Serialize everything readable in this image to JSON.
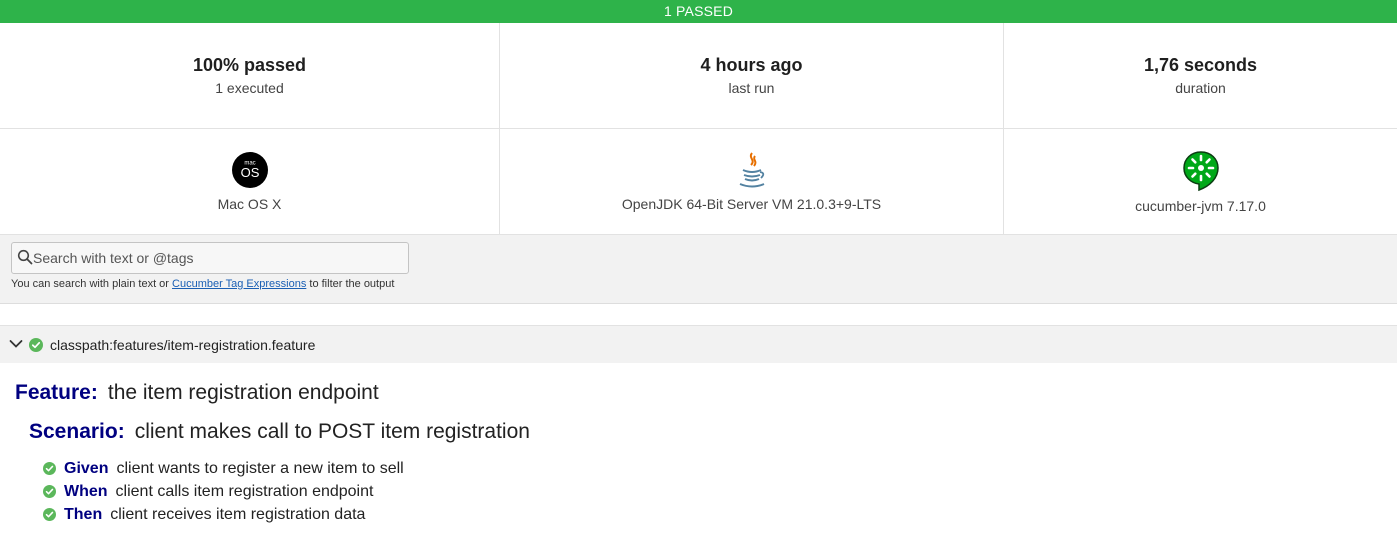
{
  "banner": {
    "text": "1 PASSED",
    "color": "#2eb34a"
  },
  "stats": {
    "passed": {
      "value": "100% passed",
      "label": "1 executed"
    },
    "last_run": {
      "value": "4 hours ago",
      "label": "last run"
    },
    "duration": {
      "value": "1,76 seconds",
      "label": "duration"
    }
  },
  "environment": {
    "os": {
      "icon": "macos-icon",
      "icon_text_top": "mac",
      "icon_text": "OS",
      "label": "Mac OS X"
    },
    "runtime": {
      "icon": "java-icon",
      "label": "OpenJDK 64-Bit Server VM 21.0.3+9-LTS"
    },
    "implementation": {
      "icon": "cucumber-icon",
      "label": "cucumber-jvm 7.17.0"
    }
  },
  "search": {
    "placeholder": "Search with text or @tags",
    "value": "",
    "help_prefix": "You can search with plain text or ",
    "help_link": "Cucumber Tag Expressions",
    "help_suffix": " to filter the output"
  },
  "feature_file": {
    "path": "classpath:features/item-registration.feature",
    "status": "passed"
  },
  "feature": {
    "keyword": "Feature:",
    "name": "the item registration endpoint",
    "scenario": {
      "keyword": "Scenario:",
      "name": "client makes call to POST item registration",
      "steps": [
        {
          "keyword": "Given",
          "text": "client wants to register a new item to sell",
          "status": "passed"
        },
        {
          "keyword": "When",
          "text": "client calls item registration endpoint",
          "status": "passed"
        },
        {
          "keyword": "Then",
          "text": "client receives item registration data",
          "status": "passed"
        }
      ]
    }
  },
  "colors": {
    "pass": "#5bb75b",
    "keyword": "#000080",
    "link": "#1a5fb4"
  }
}
